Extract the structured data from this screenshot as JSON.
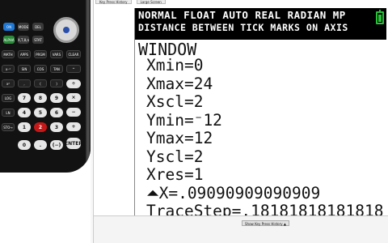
{
  "tabs": [
    "Key Press History",
    "Large Screen"
  ],
  "calculator_keys": {
    "row1": [
      "ON",
      "MODE",
      "DEL"
    ],
    "row2": [
      "ALPHA",
      "X,T,θ,n",
      "STAT"
    ],
    "row3": [
      "MATH",
      "APPS",
      "PRGM",
      "VARS",
      "CLEAR"
    ],
    "row4": [
      "x⁻¹",
      "SIN",
      "COS",
      "TAN",
      "^"
    ],
    "row5": [
      "x²",
      ",",
      "(",
      ")",
      "÷"
    ],
    "row6": [
      "LOG",
      "7",
      "8",
      "9",
      "×"
    ],
    "row7": [
      "LN",
      "4",
      "5",
      "6",
      "−"
    ],
    "row8": [
      "STO→",
      "1",
      "2",
      "3",
      "+"
    ],
    "row9": [
      "0",
      ".",
      "(−)",
      "ENTER"
    ]
  },
  "screen": {
    "status_line1": "NORMAL FLOAT AUTO REAL RADIAN MP",
    "status_line2": "DISTANCE BETWEEN TICK MARKS ON AXIS",
    "title": "WINDOW",
    "settings": [
      "Xmin=0",
      "Xmax=24",
      "Xscl=2",
      "Ymin=⁻12",
      "Ymax=12",
      "Yscl=2",
      "Xres=1",
      "⏶X=.09090909090909",
      "TraceStep=.18181818181818"
    ]
  },
  "show_history_button": "Show Key Press History ▲",
  "colors": {
    "status_bg": "#000000",
    "status_fg": "#ffffff",
    "battery": "#29c13b",
    "keypad": "#121212"
  }
}
